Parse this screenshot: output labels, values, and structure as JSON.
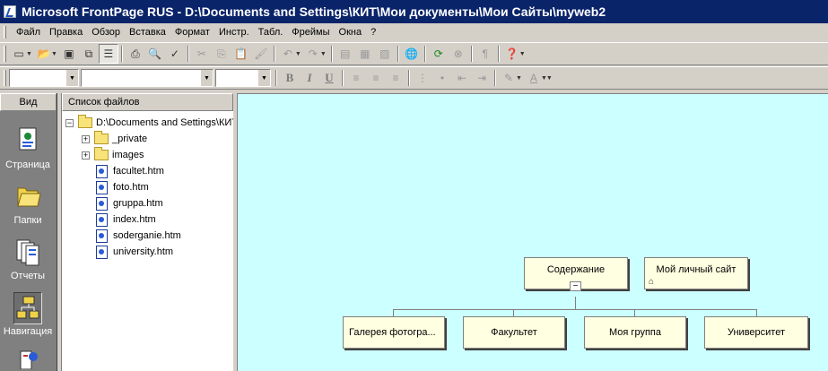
{
  "window": {
    "title": "Microsoft FrontPage RUS - D:\\Documents and Settings\\КИТ\\Мои документы\\Мои Сайты\\myweb2"
  },
  "menubar": {
    "items": [
      {
        "label": "Файл"
      },
      {
        "label": "Правка"
      },
      {
        "label": "Обзор"
      },
      {
        "label": "Вставка"
      },
      {
        "label": "Формат"
      },
      {
        "label": "Инстр."
      },
      {
        "label": "Табл."
      },
      {
        "label": "Фреймы"
      },
      {
        "label": "Окна"
      },
      {
        "label": "?"
      }
    ]
  },
  "formatting": {
    "bold": "B",
    "italic": "I",
    "underline": "U"
  },
  "views": {
    "header": "Вид",
    "items": [
      {
        "label": "Страница",
        "icon": "page-view-icon"
      },
      {
        "label": "Папки",
        "icon": "folders-view-icon"
      },
      {
        "label": "Отчеты",
        "icon": "reports-view-icon"
      },
      {
        "label": "Навигация",
        "icon": "navigation-view-icon",
        "active": true
      }
    ]
  },
  "files": {
    "header": "Список файлов",
    "root": "D:\\Documents and Settings\\КИТ",
    "folders": [
      {
        "name": "_private",
        "expander": "+"
      },
      {
        "name": "images",
        "expander": "+"
      }
    ],
    "pages": [
      "facultet.htm",
      "foto.htm",
      "gruppa.htm",
      "index.htm",
      "soderganie.htm",
      "university.htm"
    ]
  },
  "navigation": {
    "root": {
      "title": "Содержание",
      "collapse": "−"
    },
    "home": {
      "title": "Мой личный сайт"
    },
    "children": [
      {
        "title": "Галерея фотогра..."
      },
      {
        "title": "Факультет"
      },
      {
        "title": "Моя группа"
      },
      {
        "title": "Университет"
      }
    ]
  },
  "colors": {
    "titlebar": "#0a246a",
    "chrome": "#d4d0c8",
    "canvas": "#ccffff",
    "node": "#ffffe1"
  }
}
